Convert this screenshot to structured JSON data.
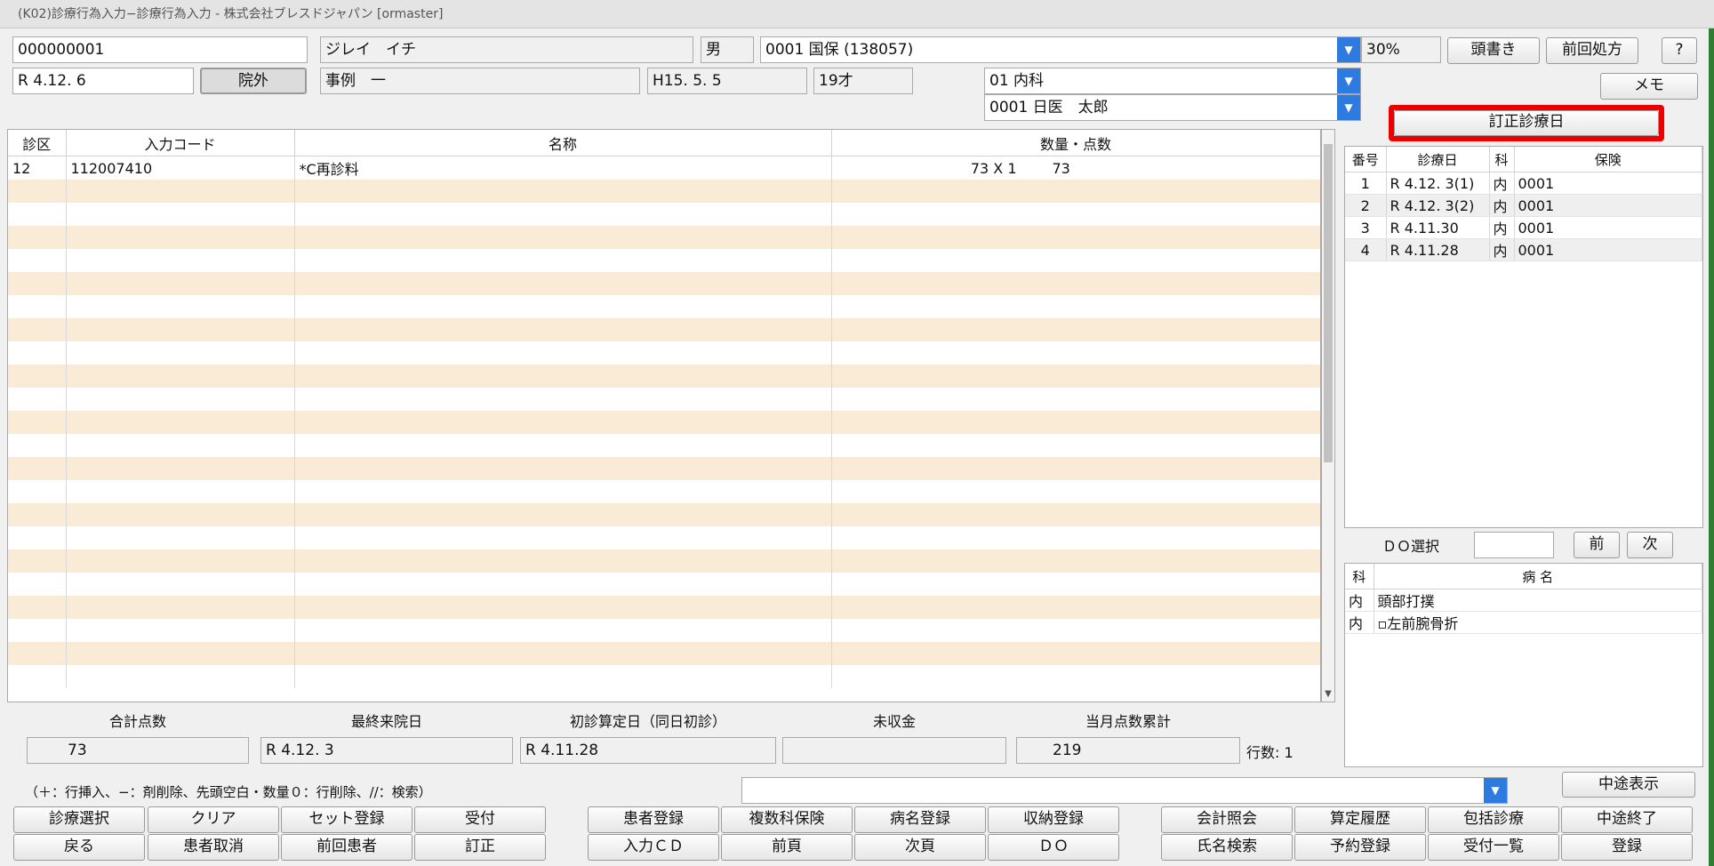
{
  "window_title": "(K02)診療行為入力−診療行為入力 - 株式会社ブレスドジャパン [ormaster]",
  "patient": {
    "id": "000000001",
    "kana_name": "ジレイ　イチ",
    "sex": "男",
    "insurance": "0001 国保 (138057)",
    "ratio": "30%",
    "visit_date": "R 4.12. 6",
    "outpatient_label": "院外",
    "name": "事例　一",
    "birth": "H15. 5. 5",
    "age": "19才",
    "department": "01 内科",
    "doctor": "0001 日医　太郎"
  },
  "top_buttons": {
    "header": "頭書き",
    "prev_rx": "前回処方",
    "help": "?",
    "memo": "メモ"
  },
  "grid": {
    "headers": [
      "診区",
      "入力コード",
      "名称",
      "数量・点数"
    ],
    "rows": [
      {
        "kubun": "12",
        "code": "112007410",
        "name": "*C再診料",
        "qty": "73 X 1",
        "points": "73"
      }
    ]
  },
  "right_panel": {
    "correction_button": "訂正診療日",
    "history_headers": [
      "番号",
      "診療日",
      "科",
      "保険"
    ],
    "history": [
      {
        "no": "1",
        "date": "R 4.12. 3(1)",
        "dept": "内",
        "ins": "0001"
      },
      {
        "no": "2",
        "date": "R 4.12. 3(2)",
        "dept": "内",
        "ins": "0001"
      },
      {
        "no": "3",
        "date": "R 4.11.30",
        "dept": "内",
        "ins": "0001"
      },
      {
        "no": "4",
        "date": "R 4.11.28",
        "dept": "内",
        "ins": "0001"
      }
    ],
    "do_label": "ＤＯ選択",
    "prev": "前",
    "next": "次",
    "disease_headers": [
      "科",
      "病 名"
    ],
    "diseases": [
      {
        "dept": "内",
        "name": "頭部打撲"
      },
      {
        "dept": "内",
        "name": "▫左前腕骨折"
      }
    ]
  },
  "summary": {
    "total_label": "合計点数",
    "total": "73",
    "last_visit_label": "最終来院日",
    "last_visit": "R 4.12. 3",
    "first_visit_label": "初診算定日（同日初診）",
    "first_visit": "R 4.11.28",
    "unpaid_label": "未収金",
    "unpaid": "",
    "monthly_label": "当月点数累計",
    "monthly": "219",
    "rows_label": "行数:",
    "rows": "1"
  },
  "hint": "（＋：行挿入、−：剤削除、先頭空白・数量０：行削除、//：検索）",
  "command_select": "",
  "fkeys": {
    "row1": [
      "診療選択",
      "クリア",
      "セット登録",
      "受付",
      "患者登録",
      "複数科保険",
      "病名登録",
      "収納登録",
      "会計照会",
      "算定履歴",
      "包括診療",
      "中途終了"
    ],
    "row2": [
      "戻る",
      "患者取消",
      "前回患者",
      "訂正",
      "入力ＣＤ",
      "前頁",
      "次頁",
      "ＤＯ",
      "氏名検索",
      "予約登録",
      "受付一覧",
      "登録"
    ],
    "midway_display": "中途表示"
  }
}
